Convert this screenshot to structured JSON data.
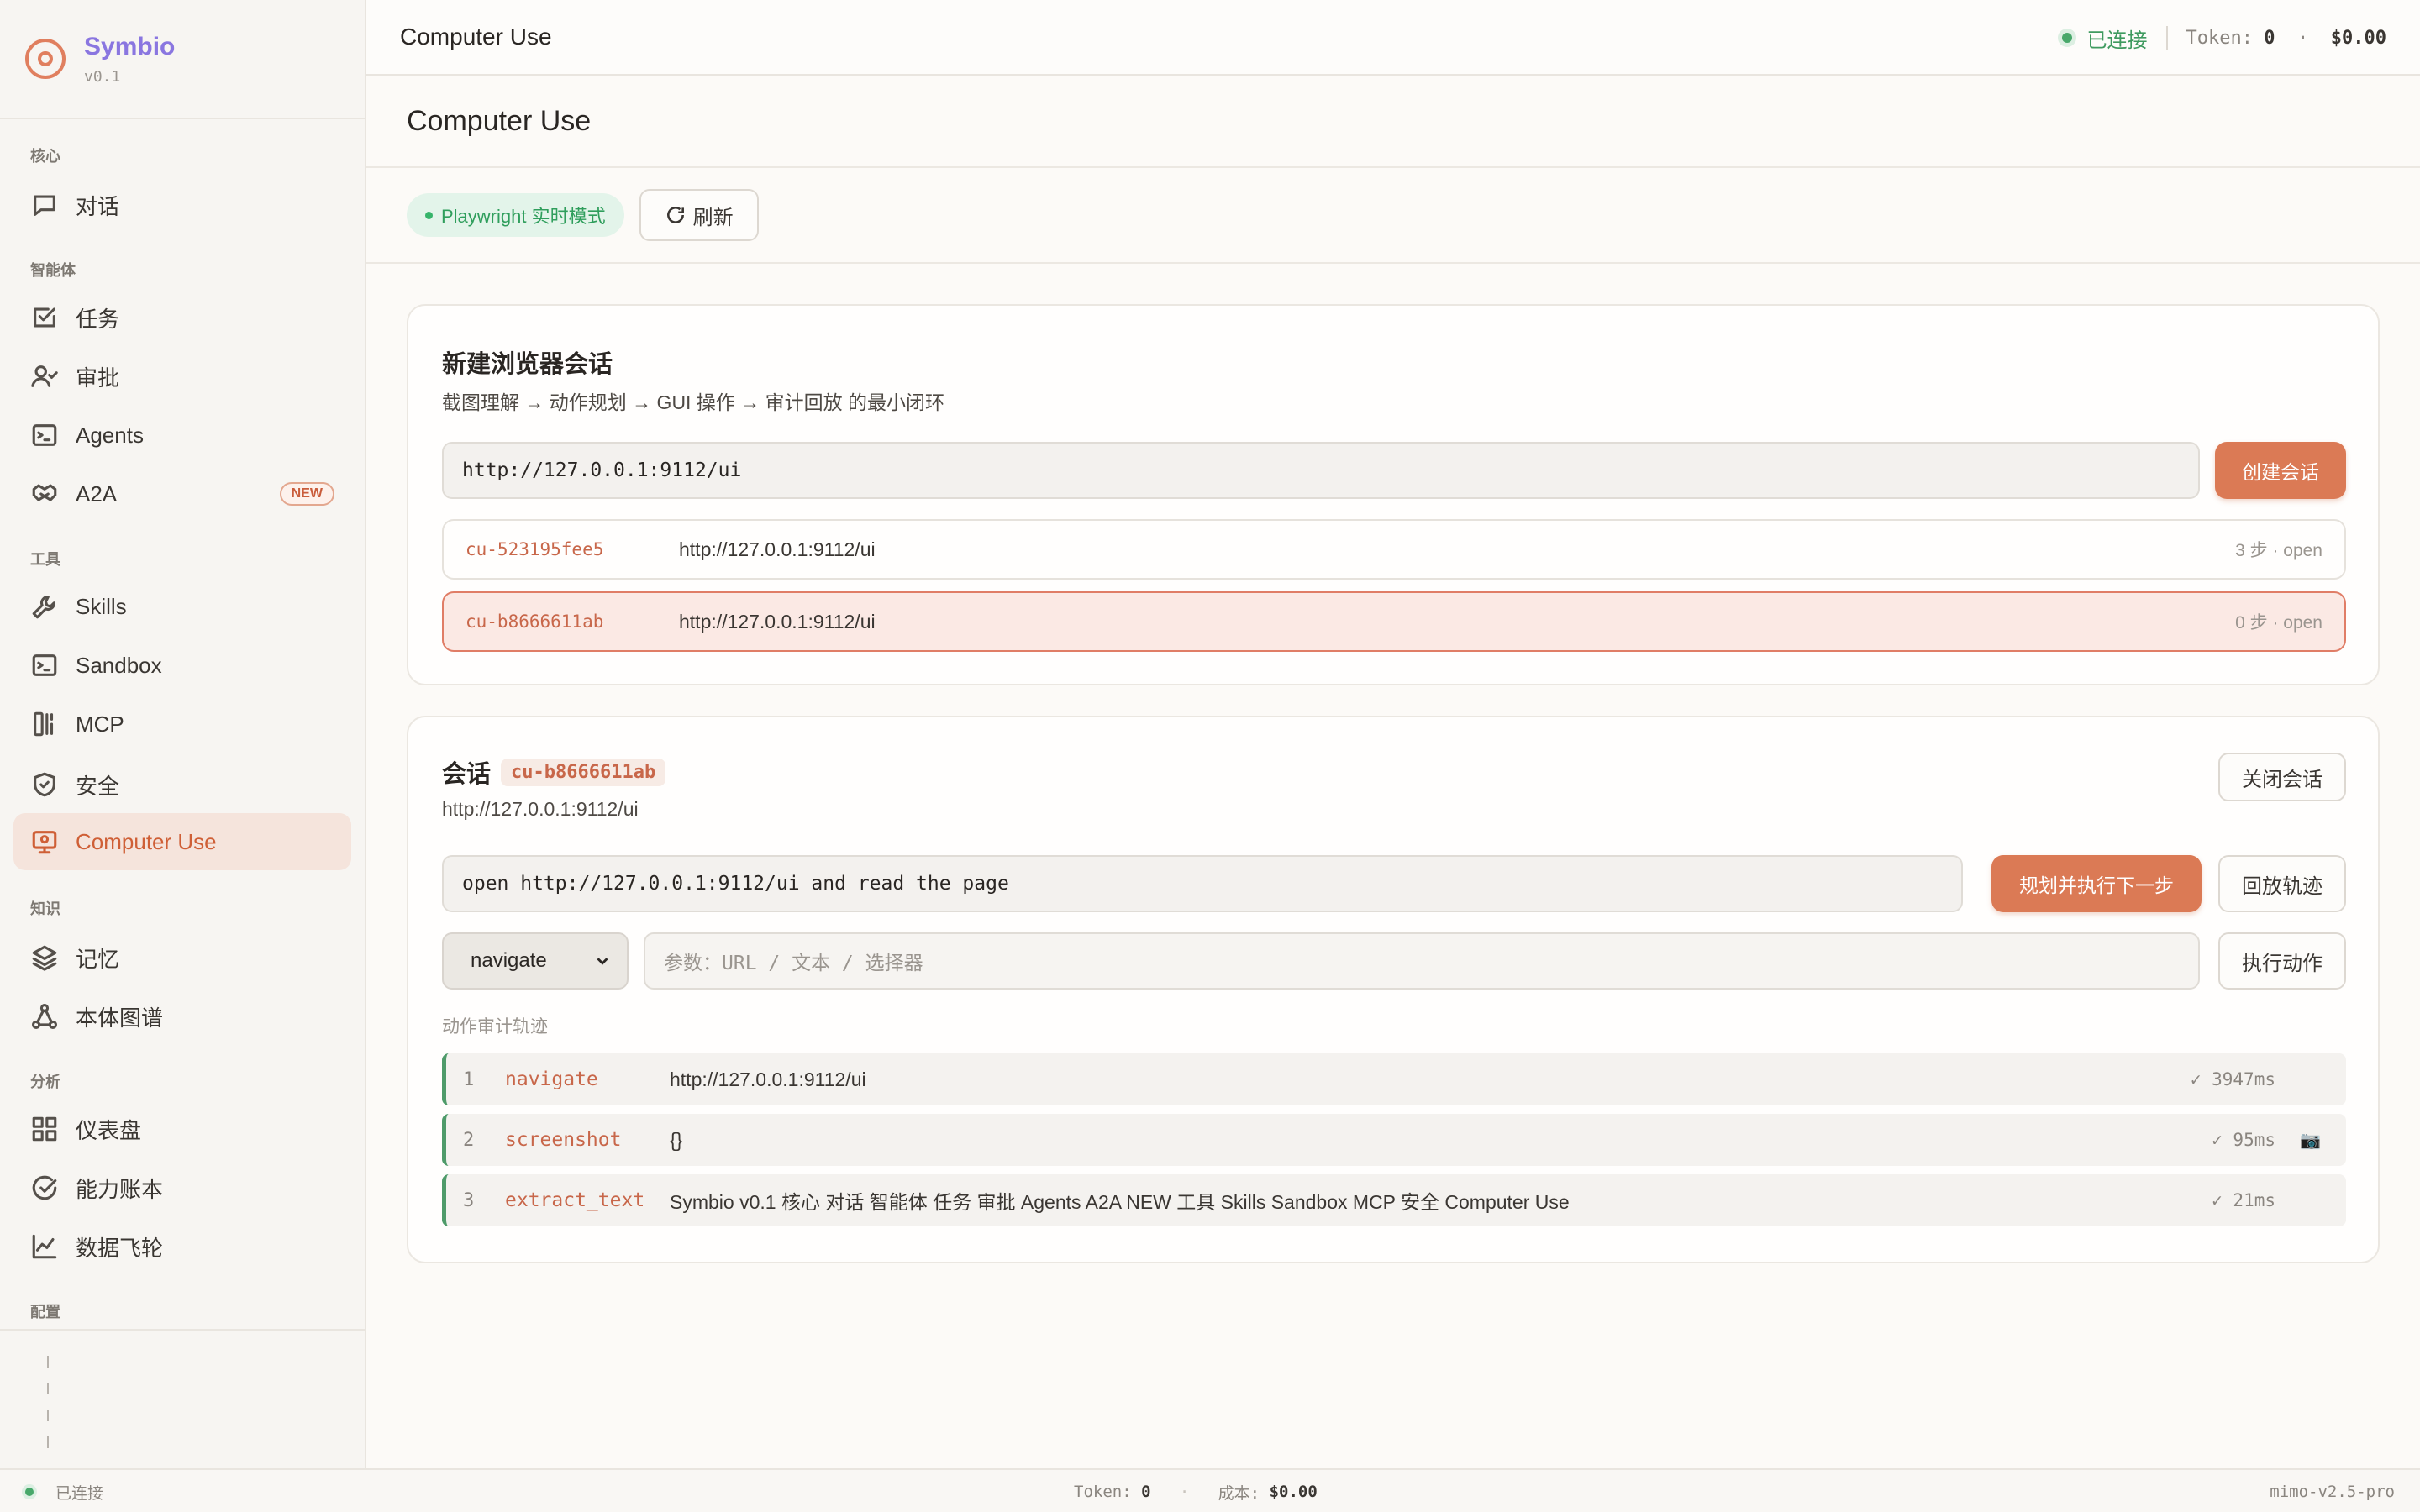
{
  "app": {
    "name": "Symbio",
    "version": "v0.1"
  },
  "sidebar": {
    "sections": {
      "core": "核心",
      "agent": "智能体",
      "tools": "工具",
      "knowledge": "知识",
      "analytics": "分析",
      "config": "配置"
    },
    "items": {
      "chat": "对话",
      "tasks": "任务",
      "approval": "审批",
      "agents": "Agents",
      "a2a": "A2A",
      "skills": "Skills",
      "sandbox": "Sandbox",
      "mcp": "MCP",
      "security": "安全",
      "computer_use": "Computer Use",
      "memory": "记忆",
      "ontology": "本体图谱",
      "dashboard": "仪表盘",
      "capability": "能力账本",
      "flywheel": "数据飞轮"
    },
    "new_badge": "NEW"
  },
  "topbar": {
    "title": "Computer Use",
    "status": "已连接",
    "token_label": "Token:",
    "token_value": "0",
    "cost_sep": "·",
    "cost": "$0.00"
  },
  "page": {
    "title": "Computer Use",
    "mode_pill": "Playwright 实时模式",
    "refresh": "刷新"
  },
  "new_session": {
    "title": "新建浏览器会话",
    "subtitle": "截图理解 → 动作规划 → GUI 操作 → 审计回放 的最小闭环",
    "url_value": "http://127.0.0.1:9112/ui",
    "create_button": "创建会话",
    "sessions": [
      {
        "id": "cu-523195fee5",
        "url": "http://127.0.0.1:9112/ui",
        "meta": "3 步 · open"
      },
      {
        "id": "cu-b8666611ab",
        "url": "http://127.0.0.1:9112/ui",
        "meta": "0 步 · open"
      }
    ]
  },
  "session": {
    "title": "会话",
    "id": "cu-b8666611ab",
    "url": "http://127.0.0.1:9112/ui",
    "close_button": "关闭会话",
    "instruction_value": "open http://127.0.0.1:9112/ui and read the page",
    "plan_button": "规划并执行下一步",
    "replay_button": "回放轨迹",
    "action_select": "navigate",
    "param_placeholder": "参数：URL / 文本 / 选择器",
    "execute_button": "执行动作",
    "audit_label": "动作审计轨迹",
    "audit": [
      {
        "n": "1",
        "action": "navigate",
        "detail": "http://127.0.0.1:9112/ui",
        "meta": "✓ 3947ms",
        "cam": ""
      },
      {
        "n": "2",
        "action": "screenshot",
        "detail": "{}",
        "meta": "✓ 95ms",
        "cam": "📷"
      },
      {
        "n": "3",
        "action": "extract_text",
        "detail": "Symbio v0.1 核心 对话 智能体 任务 审批 Agents A2A NEW 工具 Skills Sandbox MCP 安全 Computer Use",
        "meta": "✓ 21ms",
        "cam": ""
      }
    ]
  },
  "footer": {
    "status": "已连接",
    "token_label": "Token:",
    "token_value": "0",
    "sep": "·",
    "cost_label": "成本:",
    "cost_value": "$0.00",
    "model": "mimo-v2.5-pro"
  }
}
